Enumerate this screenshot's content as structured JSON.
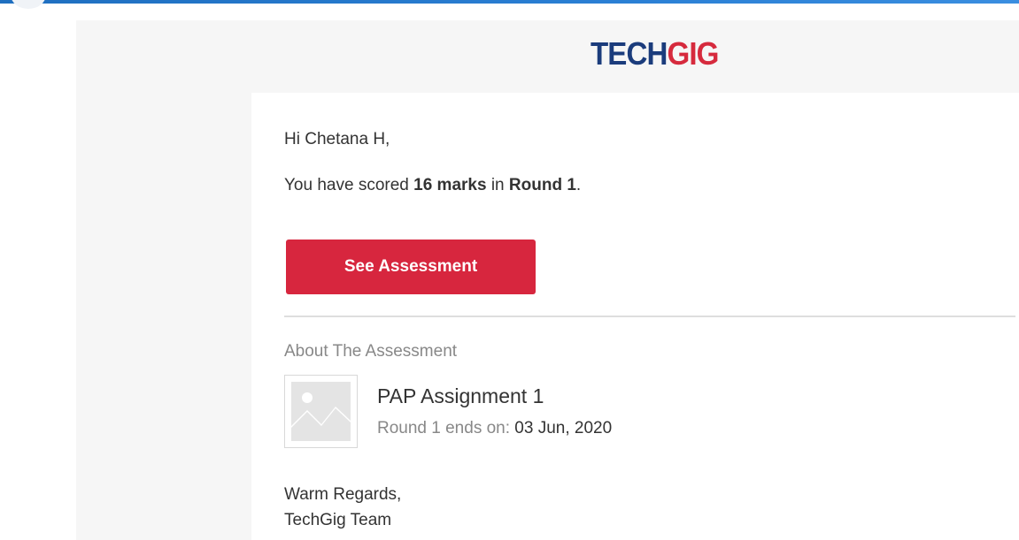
{
  "logo": {
    "part1": "TECH",
    "part2": "GIG"
  },
  "email": {
    "greeting": "Hi Chetana H,",
    "score_prefix": "You have scored ",
    "score_value": "16 marks",
    "score_middle": " in ",
    "score_round": "Round 1",
    "score_suffix": ".",
    "button_label": "See Assessment",
    "about_heading": "About The Assessment",
    "assessment_name": "PAP Assignment 1",
    "round_ends_label": "Round 1 ends on: ",
    "round_ends_date": "03 Jun, 2020",
    "sign_off": "Warm Regards,",
    "team": "TechGig Team"
  },
  "colors": {
    "brand_blue": "#1b3c7c",
    "brand_red": "#d62a3d",
    "button": "#d7263e",
    "top_bar": "#1f6fc0"
  },
  "icons": {
    "thumbnail": "image-placeholder-icon"
  }
}
